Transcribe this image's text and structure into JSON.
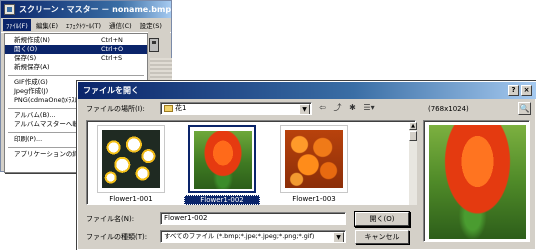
{
  "app": {
    "title": "スクリーン・マスター － noname.bmp",
    "menubar": [
      "ﾌｧｲﾙ(F)",
      "編集(E)",
      "ｴﾌｪｸﾄﾂｰﾙ(T)",
      "通信(C)",
      "設定(S)"
    ],
    "file_menu": {
      "items": [
        {
          "label": "新規作成(N)",
          "shortcut": "Ctrl+N"
        },
        {
          "label": "開く(O)",
          "shortcut": "Ctrl+O"
        },
        {
          "label": "保存(S)",
          "shortcut": "Ctrl+S"
        },
        {
          "label": "新規保存(A)",
          "shortcut": ""
        },
        {
          "label": "GIF作成(G)",
          "shortcut": ""
        },
        {
          "label": "Jpeg作成(J)",
          "shortcut": ""
        },
        {
          "label": "PNG(cdmaOneｶﾒﾗｽﾚ",
          "shortcut": ""
        },
        {
          "label": "アルバム(B)...",
          "shortcut": ""
        },
        {
          "label": "アルバムマスターへ転送(T",
          "shortcut": ""
        },
        {
          "label": "印刷(P)...",
          "shortcut": ""
        },
        {
          "label": "アプリケーションの終了(X)",
          "shortcut": ""
        }
      ]
    }
  },
  "dialog": {
    "title": "ファイルを開く",
    "title_buttons": {
      "help": "?",
      "close": "×"
    },
    "look_in_label": "ファイルの場所(I):",
    "look_in_value": "花1",
    "toolbar_icons": [
      "back-arrow-icon",
      "up-folder-icon",
      "new-folder-icon",
      "view-menu-icon"
    ],
    "files": [
      {
        "name": "Flower1-001"
      },
      {
        "name": "Flower1-002"
      },
      {
        "name": "Flower1-003"
      }
    ],
    "selected_file": "Flower1-002",
    "filename_label": "ファイル名(N):",
    "filename_value": "Flower1-002",
    "filetype_label": "ファイルの種類(T):",
    "filetype_value": "すべてのファイル (*.bmp;*.jpe;*.jpeg;*.png;*.gif)",
    "open_button": "開く(O)",
    "cancel_button": "キャンセル",
    "preview_size": "(768x1024)"
  }
}
